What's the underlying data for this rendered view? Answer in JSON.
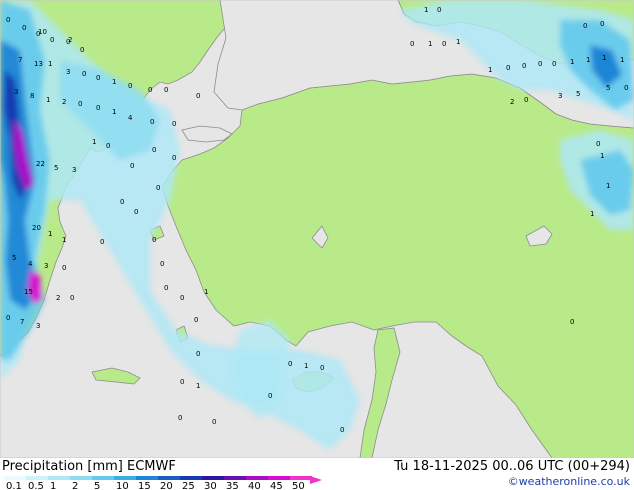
{
  "map": {
    "colors": {
      "sea": "#e6e6e6",
      "land": "#b9ea8a",
      "coast": "#8c8c8c"
    },
    "point_values": [
      "1",
      "0",
      "0",
      "0",
      "0",
      "1",
      "0",
      "1",
      "1",
      "0",
      "0",
      "0",
      "0",
      "1",
      "1",
      "1",
      "1",
      "5",
      "0",
      "3",
      "5",
      "2",
      "0",
      "0",
      "1",
      "1",
      "1",
      "0",
      "0",
      "0",
      "0",
      "0",
      "0",
      "0",
      "0",
      "1",
      "0",
      "0",
      "0",
      "10",
      "2",
      "7",
      "13",
      "1",
      "3",
      "0",
      "3",
      "8",
      "1",
      "2",
      "0",
      "0",
      "1",
      "4",
      "0",
      "22",
      "5",
      "3",
      "1",
      "0",
      "0",
      "0",
      "0",
      "0",
      "0",
      "20",
      "1",
      "1",
      "0",
      "0",
      "0",
      "0",
      "5",
      "4",
      "3",
      "0",
      "15",
      "2",
      "0",
      "0",
      "7",
      "3",
      "0",
      "0",
      "0",
      "0",
      "1",
      "0",
      "1",
      "0",
      "0",
      "0",
      "0",
      "1",
      "0",
      "0",
      "0",
      "0"
    ]
  },
  "footer": {
    "title": "Precipitation [mm]  ECMWF",
    "run": "Tu 18-11-2025 00..06 UTC (00+294)",
    "credit": "©weatheronline.co.uk"
  },
  "legend": {
    "labels": [
      "0.1",
      "0.5",
      "1",
      "2",
      "5",
      "10",
      "15",
      "20",
      "25",
      "30",
      "35",
      "40",
      "45",
      "50"
    ],
    "colors": [
      "#e9fbff",
      "#cdf2fb",
      "#aee8f6",
      "#8edcf2",
      "#64c9ec",
      "#3aafe3",
      "#1e86d6",
      "#1a5cc4",
      "#183bb0",
      "#2a18a0",
      "#6b10b4",
      "#a80cc8",
      "#d80cd0",
      "#f232cc"
    ]
  }
}
